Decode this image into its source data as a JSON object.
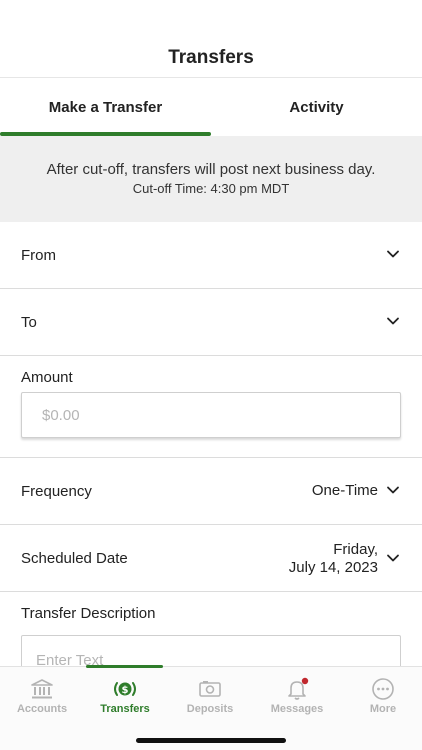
{
  "header": {
    "title": "Transfers"
  },
  "tabs": [
    {
      "label": "Make a Transfer",
      "active": true
    },
    {
      "label": "Activity",
      "active": false
    }
  ],
  "notice": {
    "line1": "After cut-off, transfers will post next business day.",
    "line2": "Cut-off Time: 4:30 pm MDT"
  },
  "form": {
    "from": {
      "label": "From"
    },
    "to": {
      "label": "To"
    },
    "amount": {
      "label": "Amount",
      "placeholder": "$0.00"
    },
    "frequency": {
      "label": "Frequency",
      "value": "One-Time"
    },
    "scheduled_date": {
      "label": "Scheduled Date",
      "value_line1": "Friday,",
      "value_line2": "July 14, 2023"
    },
    "description": {
      "label": "Transfer Description",
      "placeholder": "Enter Text"
    }
  },
  "bottom_nav": [
    {
      "label": "Accounts",
      "icon": "bank-icon",
      "active": false
    },
    {
      "label": "Transfers",
      "icon": "transfer-dollar-icon",
      "active": true
    },
    {
      "label": "Deposits",
      "icon": "deposit-camera-icon",
      "active": false
    },
    {
      "label": "Messages",
      "icon": "bell-icon",
      "active": false,
      "badge": true
    },
    {
      "label": "More",
      "icon": "more-dots-icon",
      "active": false
    }
  ],
  "colors": {
    "accent": "#2f7d2b",
    "badge": "#c0272d",
    "notice_bg": "#efefef"
  }
}
